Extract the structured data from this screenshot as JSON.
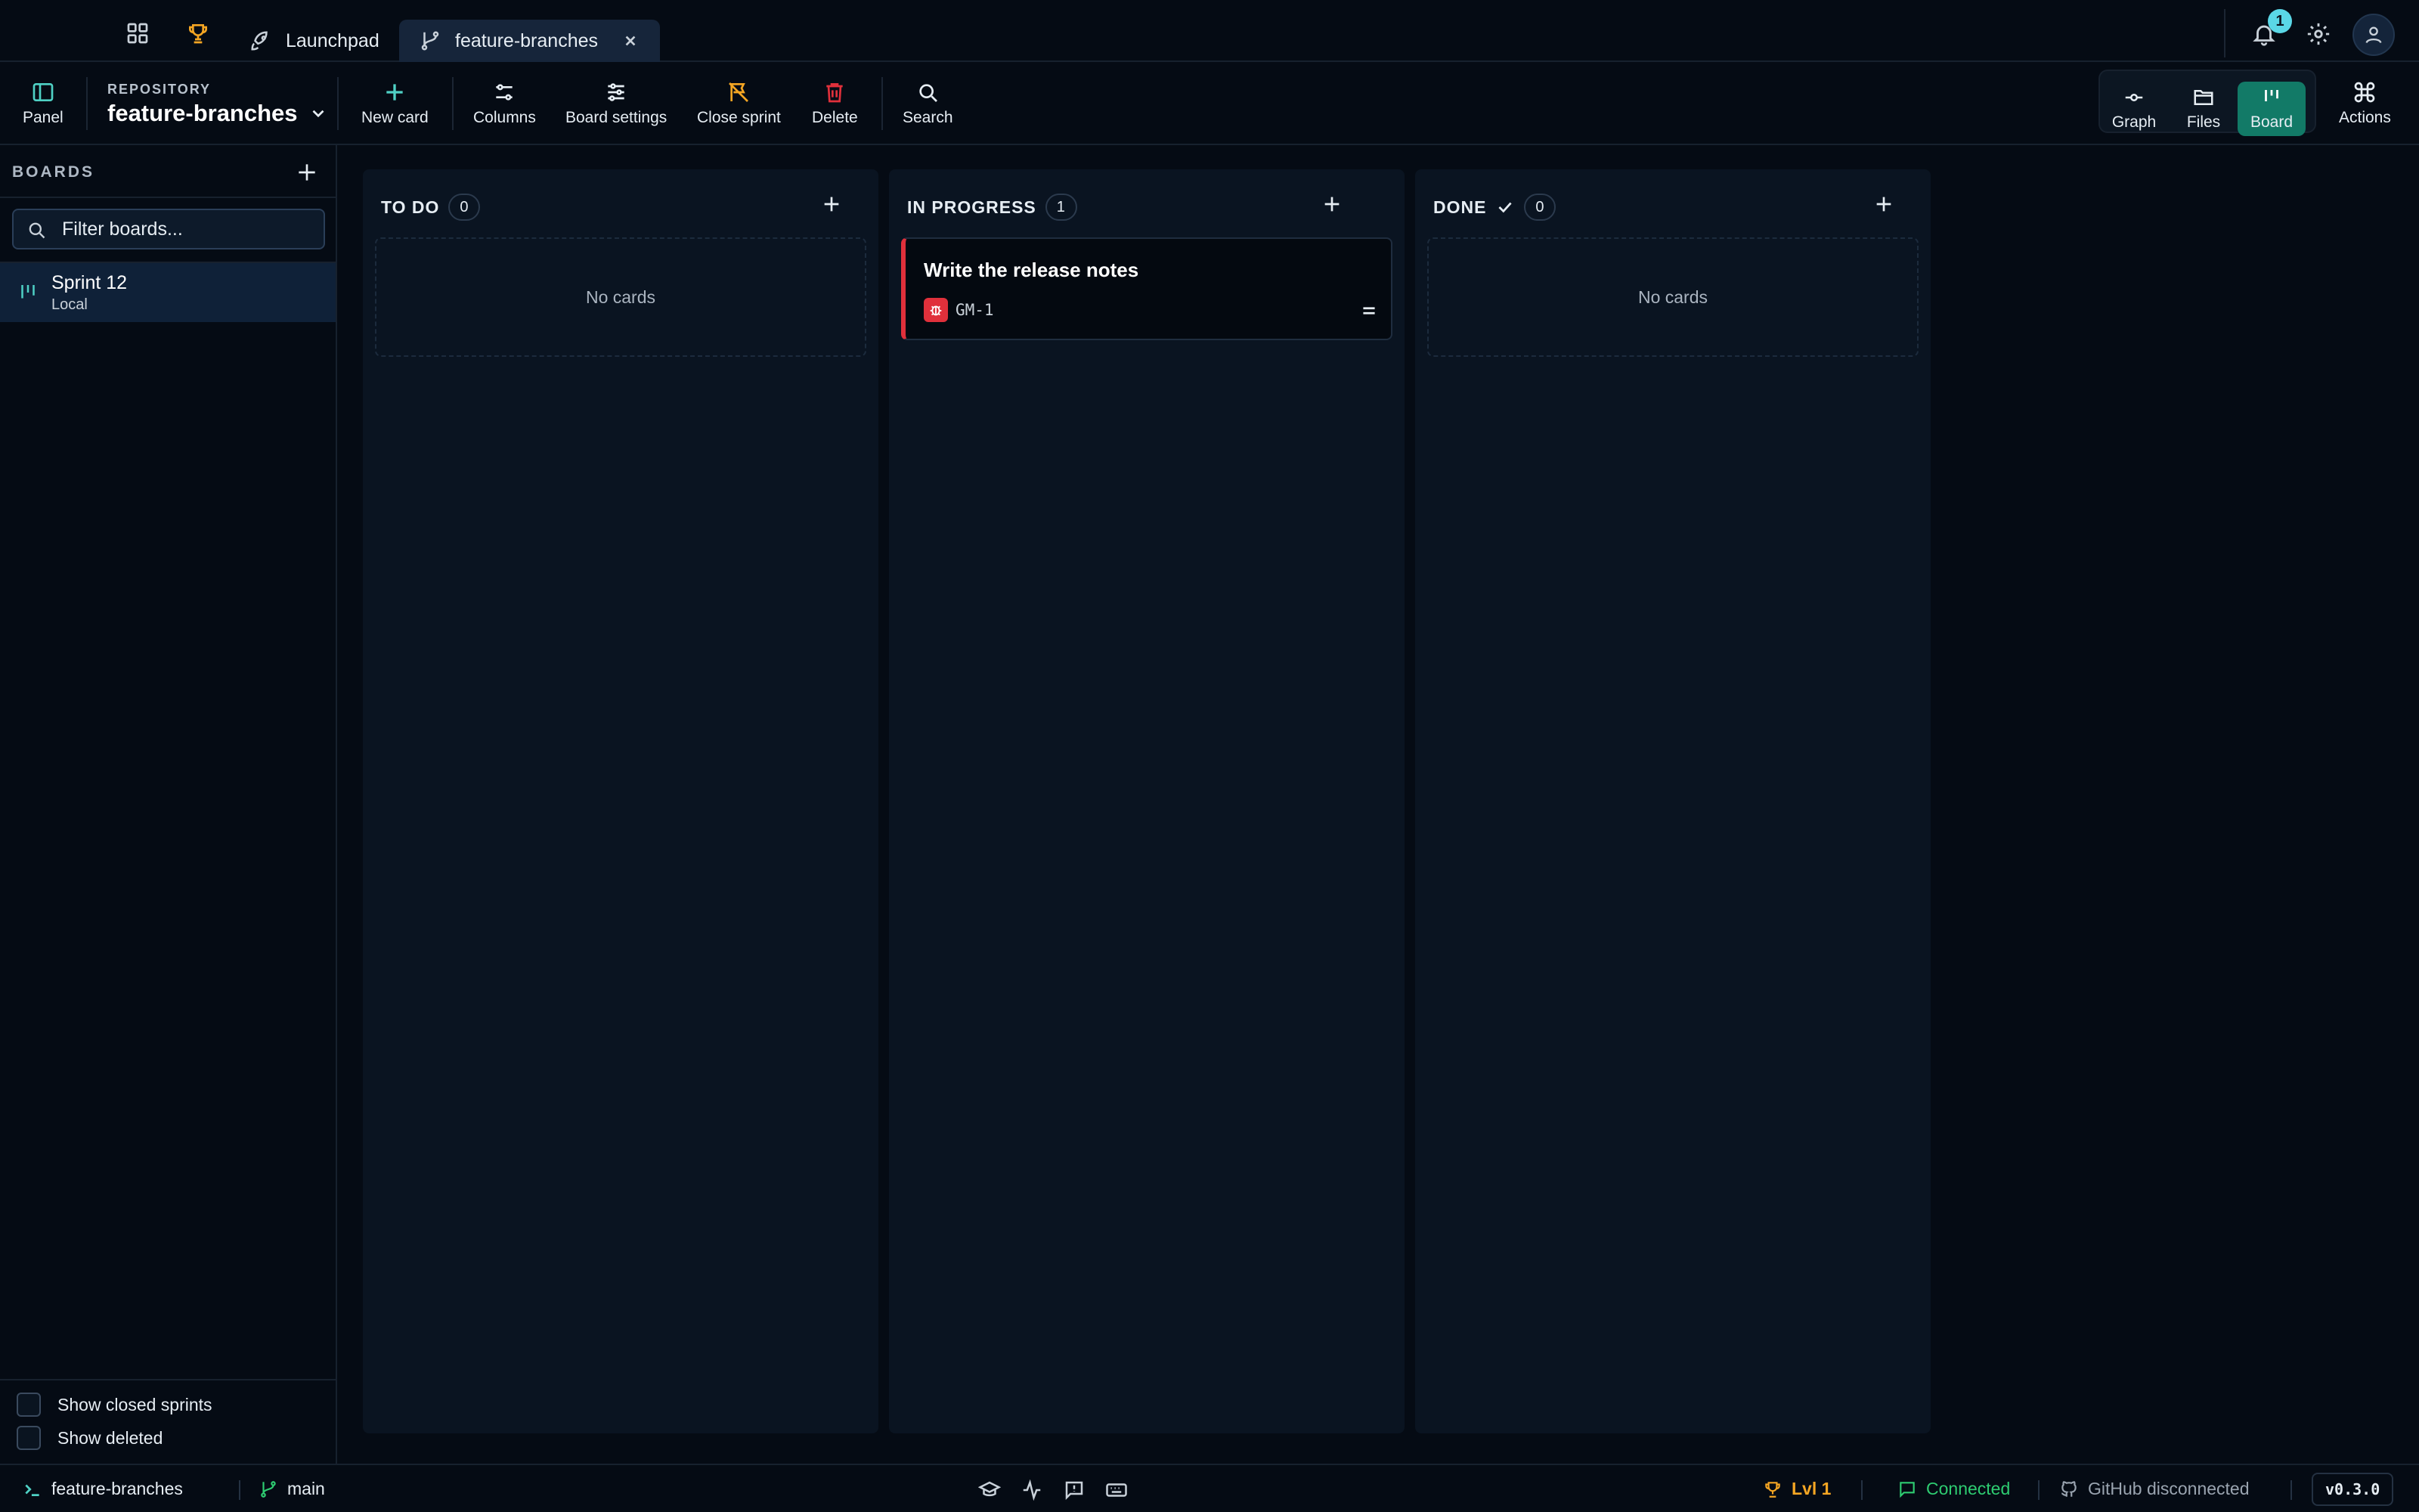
{
  "tabs": [
    {
      "label": "Launchpad",
      "icon": "rocket-icon"
    },
    {
      "label": "feature-branches",
      "icon": "branch-icon",
      "active": true
    }
  ],
  "notifications": {
    "count": "1"
  },
  "toolbar": {
    "panel_label": "Panel",
    "repo_caption": "REPOSITORY",
    "repo_name": "feature-branches",
    "new_card": "New card",
    "columns": "Columns",
    "board_settings": "Board settings",
    "close_sprint": "Close sprint",
    "delete": "Delete",
    "search": "Search",
    "views": {
      "graph": "Graph",
      "files": "Files",
      "board": "Board",
      "actions": "Actions"
    },
    "active_view": "Board"
  },
  "sidebar": {
    "title": "BOARDS",
    "filter_placeholder": "Filter boards...",
    "boards": [
      {
        "name": "Sprint 12",
        "subtitle": "Local"
      }
    ],
    "show_closed": "Show closed sprints",
    "show_deleted": "Show deleted"
  },
  "board": {
    "columns": [
      {
        "title": "TO DO",
        "count": "0",
        "empty_text": "No cards"
      },
      {
        "title": "IN PROGRESS",
        "count": "1",
        "cards": [
          {
            "title": "Write the release notes",
            "id": "GM-1",
            "type": "bug"
          }
        ]
      },
      {
        "title": "DONE",
        "count": "0",
        "empty_text": "No cards"
      }
    ]
  },
  "status": {
    "repo": "feature-branches",
    "branch": "main",
    "level": "Lvl 1",
    "connection": "Connected",
    "github": "GitHub disconnected",
    "version": "v0.3.0"
  },
  "colors": {
    "accent": "#127a67",
    "teal": "#4fd1c5",
    "danger": "#e0303b",
    "trophy": "#f5a623",
    "success": "#2ecc71"
  }
}
